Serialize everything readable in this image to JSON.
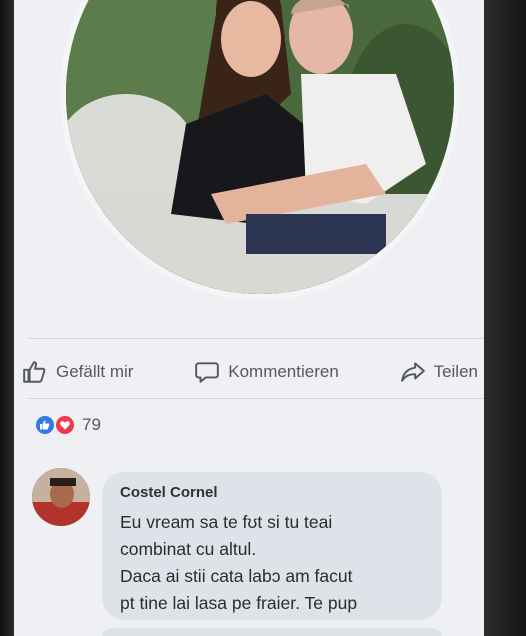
{
  "post_actions": {
    "like_label": "Gefällt mir",
    "comment_label": "Kommentieren",
    "share_label": "Teilen"
  },
  "reactions": {
    "count": "79"
  },
  "comment": {
    "author": "Costel Cornel",
    "lines": [
      "Eu vream sa te fʊt si tu teai",
      "combinat cu altul.",
      "Daca ai stii cata labɔ am facut",
      "pt tine lai lasa pe fraier. Te pup"
    ]
  },
  "colors": {
    "like_reaction": "#3578e5",
    "love_reaction": "#ef3b4d",
    "comment_bubble": "#dfe3e9"
  }
}
